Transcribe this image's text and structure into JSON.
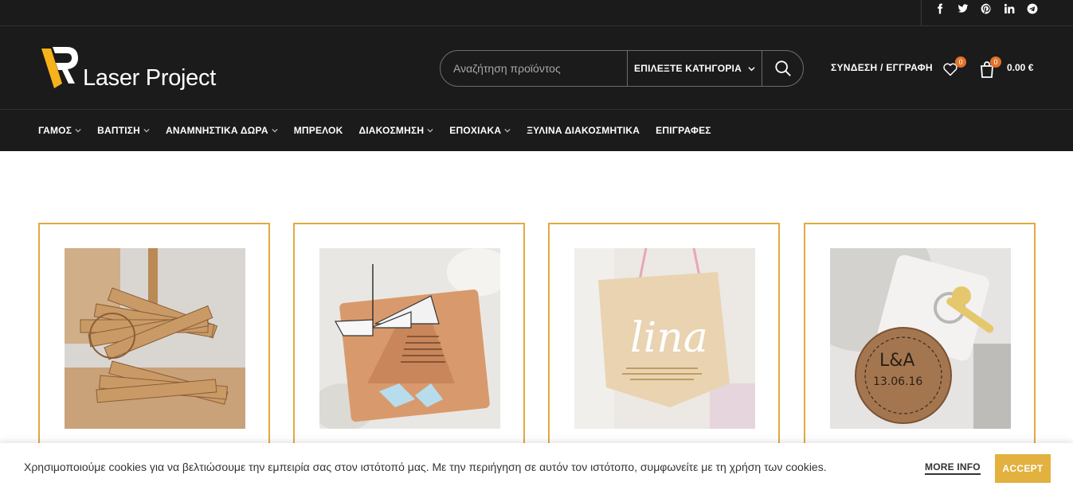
{
  "brand": {
    "name": "Laser Project",
    "accent": "#e2a93f",
    "logo_color": "#f5b21b"
  },
  "social": [
    "facebook-icon",
    "twitter-icon",
    "pinterest-icon",
    "linkedin-icon",
    "telegram-icon"
  ],
  "search": {
    "placeholder": "Αναζήτηση προϊόντος",
    "category_label": "ΕΠΙΛΕΞΤΕ ΚΑΤΗΓΟΡΙΑ"
  },
  "account": {
    "login_label": "ΣΥΝΔΕΣΗ / ΕΓΓΡΑΦΗ",
    "wishlist_count": "0",
    "cart_count": "0",
    "cart_total": "0.00 €"
  },
  "nav": {
    "items": [
      {
        "label": "ΓΑΜΟΣ",
        "dropdown": true
      },
      {
        "label": "ΒΑΠΤΙΣΗ",
        "dropdown": true
      },
      {
        "label": "ΑΝΑΜΝΗΣΤΙΚΑ ΔΩΡΑ",
        "dropdown": true
      },
      {
        "label": "ΜΠΡΕΛΟΚ",
        "dropdown": false
      },
      {
        "label": "ΔΙΑΚΟΣΜΗΣΗ",
        "dropdown": true
      },
      {
        "label": "ΕΠΟΧΙΑΚΑ",
        "dropdown": true
      },
      {
        "label": "ΞΥΛΙΝΑ ΔΙΑΚΟΣΜΗΤΙΚΑ",
        "dropdown": false
      },
      {
        "label": "ΕΠΙΓΡΑΦΕΣ",
        "dropdown": false
      }
    ]
  },
  "products": {
    "p3_text": "lina",
    "p4_text_line1": "L&A",
    "p4_text_line2": "13.06.16"
  },
  "cookie": {
    "message": "Χρησιμοποιούμε cookies για να βελτιώσουμε την εμπειρία σας στον ιστότοπό μας. Με την περιήγηση σε αυτόν τον ιστότοπο, συμφωνείτε με τη χρήση των cookies.",
    "more_info": "MORE INFO",
    "accept": "ACCEPT"
  }
}
